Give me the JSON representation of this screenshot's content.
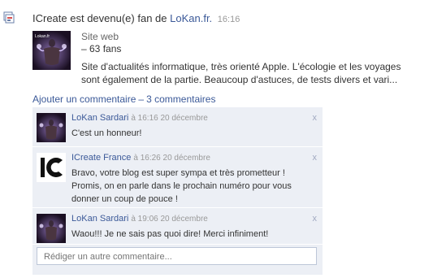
{
  "story": {
    "actor": "ICreate",
    "action_text": " est devenu(e) fan de ",
    "page_name": "LoKan.fr.",
    "time": "16:16"
  },
  "page": {
    "thumb_label": "Lokan.fr",
    "category": "Site web",
    "fans": "– 63 fans",
    "description": "Site d'actualités informatique, très orienté Apple. L'écologie et les voyages sont également de la partie. Beaucoup d'astuces, de tests divers et vari..."
  },
  "actions": {
    "comment_link": "Ajouter un commentaire",
    "separator": "–",
    "count_link": "3 commentaires"
  },
  "comments": [
    {
      "author": "LoKan Sardari",
      "time": "à 16:16 20 décembre",
      "text": "C'est un honneur!",
      "avatar": "lokan"
    },
    {
      "author": "ICreate France",
      "time": "à 16:26 20 décembre",
      "text": "Bravo, votre blog est super sympa et très prometteur ! Promis, on en parle dans le prochain numéro pour vous donner un coup de pouce !",
      "avatar": "icreate"
    },
    {
      "author": "LoKan Sardari",
      "time": "à 19:06 20 décembre",
      "text": "Waou!!! Je ne sais pas quoi dire! Merci infiniment!",
      "avatar": "lokan"
    }
  ],
  "close_glyph": "x",
  "new_comment": {
    "placeholder": "Rédiger un autre commentaire..."
  },
  "colors": {
    "link": "#3b5998",
    "comment_bg": "#eceff5",
    "muted": "#999999"
  }
}
